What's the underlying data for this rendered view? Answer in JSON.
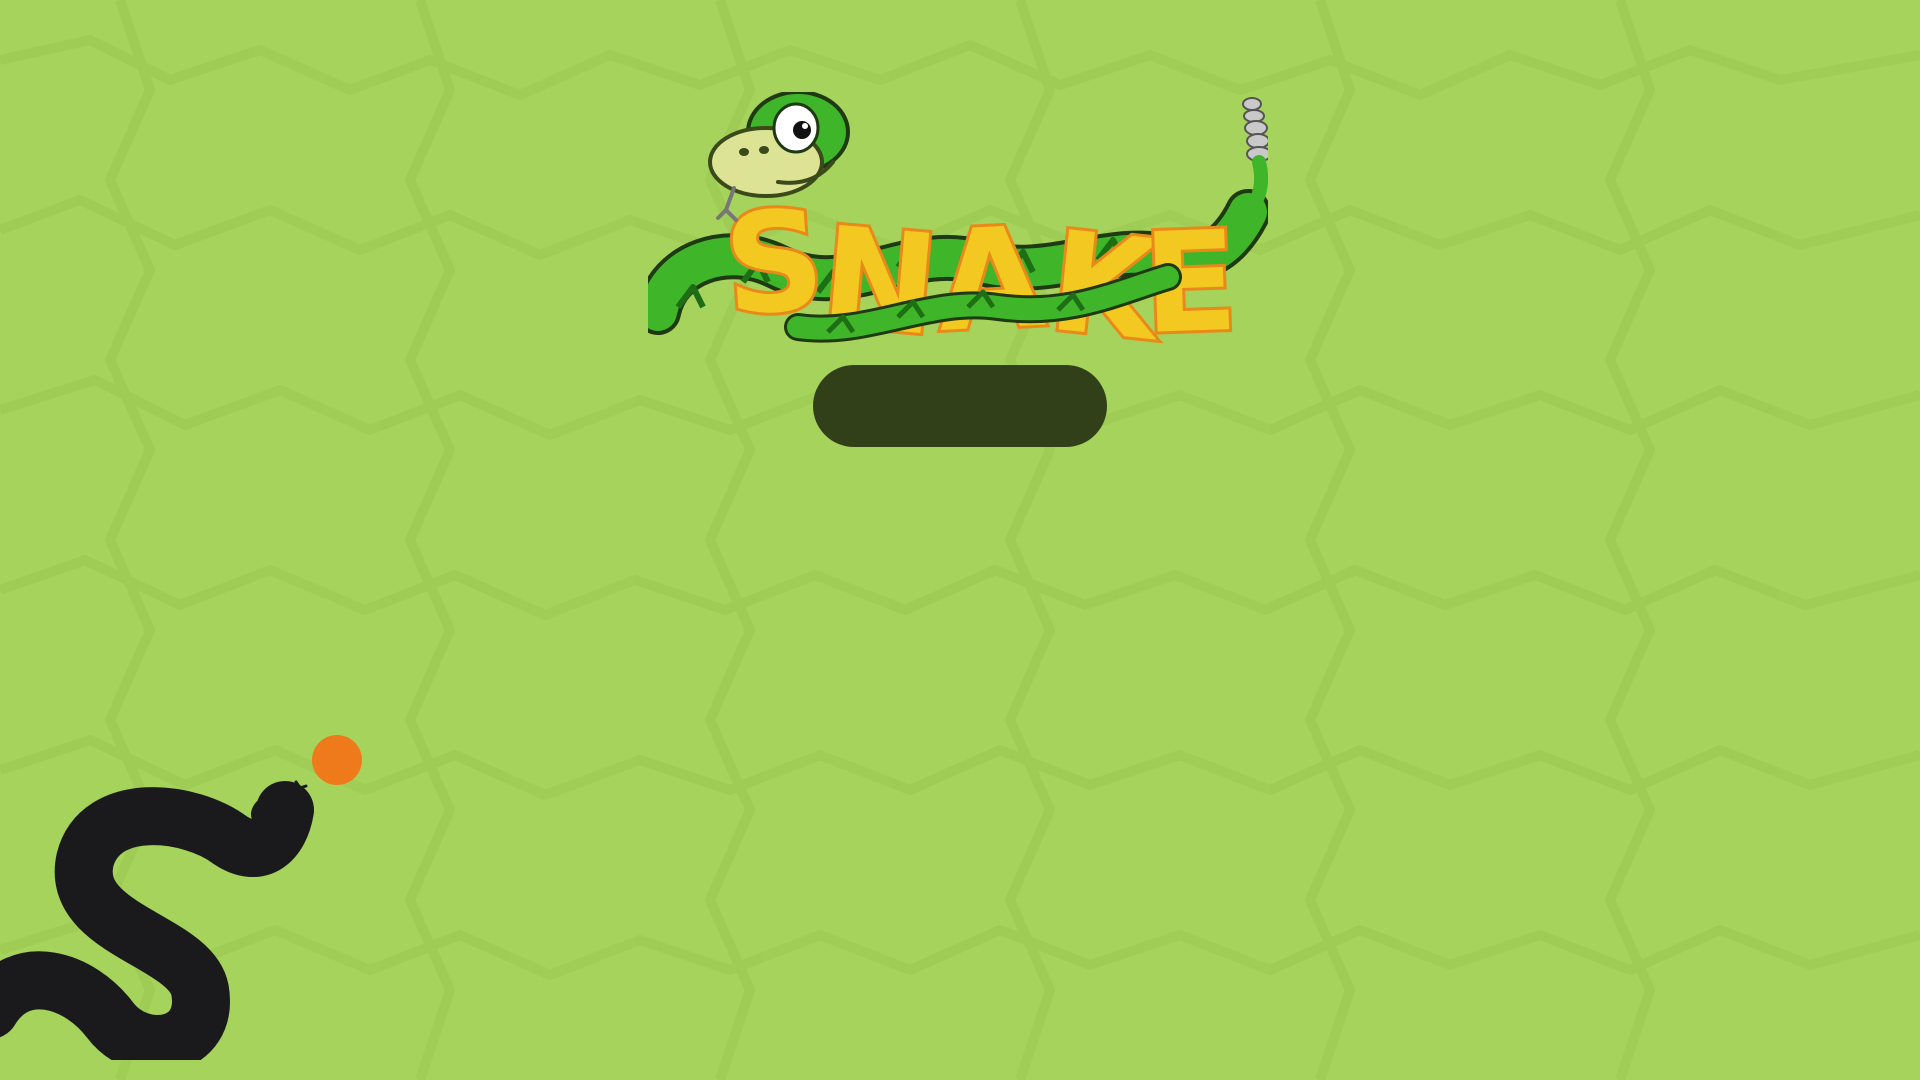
{
  "logo": {
    "title": "SNAKE"
  },
  "menu": {
    "play_label": ""
  },
  "colors": {
    "background": "#a6d35b",
    "button": "#314019",
    "logo_letters": "#f3c820",
    "logo_outline": "#e8891a",
    "snake_green": "#3fb52a",
    "food": "#ee7a1b",
    "decor_snake": "#1a1a1c"
  },
  "icons": {
    "logo": "snake-logo-icon",
    "decor": "snake-silhouette-icon",
    "food": "food-dot-icon"
  }
}
